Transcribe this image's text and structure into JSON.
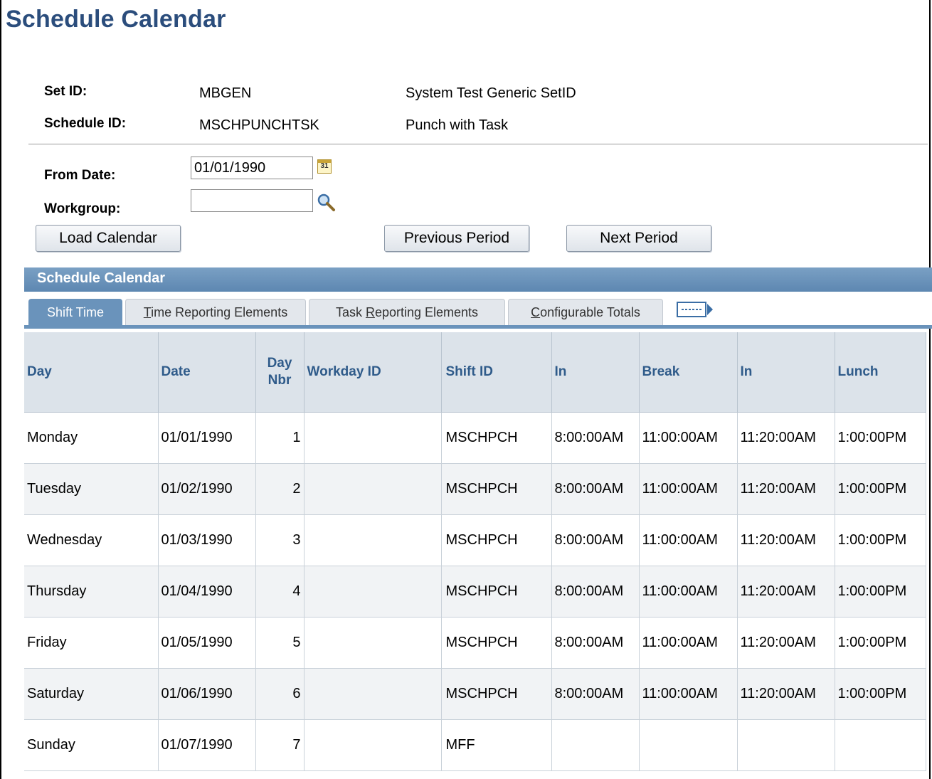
{
  "page": {
    "title": "Schedule Calendar"
  },
  "header": {
    "set_id_label": "Set ID:",
    "set_id_value": "MBGEN",
    "set_id_desc": "System Test Generic SetID",
    "schedule_id_label": "Schedule ID:",
    "schedule_id_value": "MSCHPUNCHTSK",
    "schedule_id_desc": "Punch with Task"
  },
  "form": {
    "from_date_label": "From Date:",
    "from_date_value": "01/01/1990",
    "workgroup_label": "Workgroup:",
    "workgroup_value": ""
  },
  "buttons": {
    "load_calendar": "Load Calendar",
    "previous_period": "Previous Period",
    "next_period": "Next Period"
  },
  "grid": {
    "title": "Schedule Calendar",
    "tabs": {
      "shift_time": "Shift Time",
      "time_reporting": {
        "pre": "",
        "u": "T",
        "post": "ime Reporting Elements"
      },
      "task_reporting": {
        "pre": "Task ",
        "u": "R",
        "post": "eporting Elements"
      },
      "configurable": {
        "pre": "",
        "u": "C",
        "post": "onfigurable Totals"
      }
    },
    "columns": {
      "day": "Day",
      "date": "Date",
      "day_nbr_1": "Day",
      "day_nbr_2": "Nbr",
      "workday_id": "Workday ID",
      "shift_id": "Shift ID",
      "in1": "In",
      "break": "Break",
      "in2": "In",
      "lunch": "Lunch"
    },
    "rows": [
      {
        "day": "Monday",
        "date": "01/01/1990",
        "nbr": "1",
        "workday": "",
        "shift": "MSCHPCH",
        "in1": "8:00:00AM",
        "break": "11:00:00AM",
        "in2": "11:20:00AM",
        "lunch": "1:00:00PM"
      },
      {
        "day": "Tuesday",
        "date": "01/02/1990",
        "nbr": "2",
        "workday": "",
        "shift": "MSCHPCH",
        "in1": "8:00:00AM",
        "break": "11:00:00AM",
        "in2": "11:20:00AM",
        "lunch": "1:00:00PM"
      },
      {
        "day": "Wednesday",
        "date": "01/03/1990",
        "nbr": "3",
        "workday": "",
        "shift": "MSCHPCH",
        "in1": "8:00:00AM",
        "break": "11:00:00AM",
        "in2": "11:20:00AM",
        "lunch": "1:00:00PM"
      },
      {
        "day": "Thursday",
        "date": "01/04/1990",
        "nbr": "4",
        "workday": "",
        "shift": "MSCHPCH",
        "in1": "8:00:00AM",
        "break": "11:00:00AM",
        "in2": "11:20:00AM",
        "lunch": "1:00:00PM"
      },
      {
        "day": "Friday",
        "date": "01/05/1990",
        "nbr": "5",
        "workday": "",
        "shift": "MSCHPCH",
        "in1": "8:00:00AM",
        "break": "11:00:00AM",
        "in2": "11:20:00AM",
        "lunch": "1:00:00PM"
      },
      {
        "day": "Saturday",
        "date": "01/06/1990",
        "nbr": "6",
        "workday": "",
        "shift": "MSCHPCH",
        "in1": "8:00:00AM",
        "break": "11:00:00AM",
        "in2": "11:20:00AM",
        "lunch": "1:00:00PM"
      },
      {
        "day": "Sunday",
        "date": "01/07/1990",
        "nbr": "7",
        "workday": "",
        "shift": "MFF",
        "in1": "",
        "break": "",
        "in2": "",
        "lunch": ""
      }
    ]
  },
  "icons": {
    "calendar": "calendar-icon",
    "lookup": "magnifier-icon",
    "show_all_columns": "show-all-columns-icon"
  },
  "colors": {
    "title": "#2b4d7c",
    "grid_header_bar": "#6a93bb",
    "column_header_text": "#2f5b8a",
    "column_header_bg": "#dce3ea"
  }
}
